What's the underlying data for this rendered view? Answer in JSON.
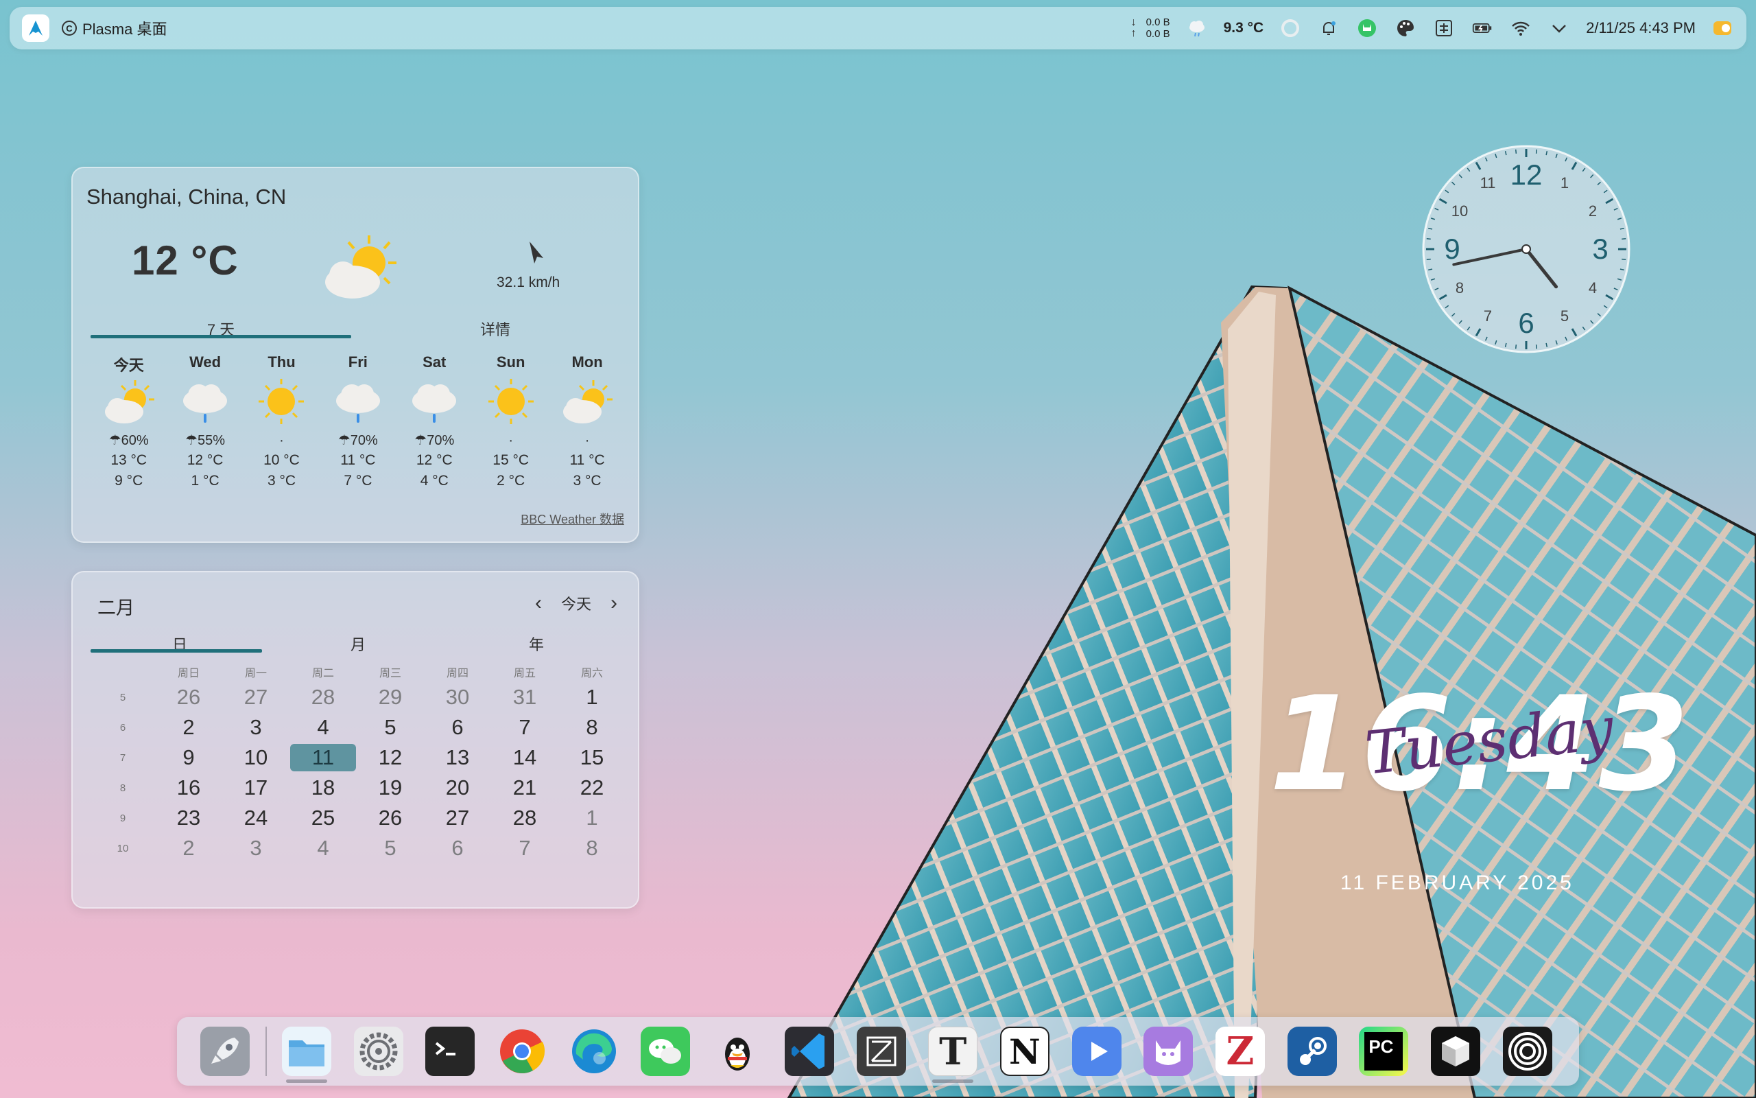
{
  "panel": {
    "app_title": "Plasma 桌面",
    "net_down": "0.0 B",
    "net_up": "0.0 B",
    "weather_temp": "9.3 °C",
    "datetime": "2/11/25 4:43 PM"
  },
  "weather": {
    "location": "Shanghai, China, CN",
    "temperature": "12 °C",
    "wind": "32.1 km/h",
    "tabs": [
      "7 天",
      "详情"
    ],
    "days": [
      {
        "name": "今天",
        "icon": "partly-cloudy-icon",
        "precip": "☂60%",
        "high": "13 °C",
        "low": "9 °C"
      },
      {
        "name": "Wed",
        "icon": "cloud-rain-icon",
        "precip": "☂55%",
        "high": "12 °C",
        "low": "1 °C"
      },
      {
        "name": "Thu",
        "icon": "sun-icon",
        "precip": "·",
        "high": "10 °C",
        "low": "3 °C"
      },
      {
        "name": "Fri",
        "icon": "cloud-rain-icon",
        "precip": "☂70%",
        "high": "11 °C",
        "low": "7 °C"
      },
      {
        "name": "Sat",
        "icon": "cloud-rain-icon",
        "precip": "☂70%",
        "high": "12 °C",
        "low": "4 °C"
      },
      {
        "name": "Sun",
        "icon": "sun-icon",
        "precip": "·",
        "high": "15 °C",
        "low": "2 °C"
      },
      {
        "name": "Mon",
        "icon": "partly-cloudy-icon",
        "precip": "·",
        "high": "11 °C",
        "low": "3 °C"
      }
    ],
    "source": "BBC Weather 数据"
  },
  "calendar": {
    "month": "二月",
    "today_label": "今天",
    "tabs": [
      "日",
      "月",
      "年"
    ],
    "weekdays": [
      "周日",
      "周一",
      "周二",
      "周三",
      "周四",
      "周五",
      "周六"
    ],
    "weeks": [
      {
        "num": "5",
        "days": [
          "26",
          "27",
          "28",
          "29",
          "30",
          "31",
          "1"
        ]
      },
      {
        "num": "6",
        "days": [
          "2",
          "3",
          "4",
          "5",
          "6",
          "7",
          "8"
        ]
      },
      {
        "num": "7",
        "days": [
          "9",
          "10",
          "11",
          "12",
          "13",
          "14",
          "15"
        ]
      },
      {
        "num": "8",
        "days": [
          "16",
          "17",
          "18",
          "19",
          "20",
          "21",
          "22"
        ]
      },
      {
        "num": "9",
        "days": [
          "23",
          "24",
          "25",
          "26",
          "27",
          "28",
          "1"
        ]
      },
      {
        "num": "10",
        "days": [
          "2",
          "3",
          "4",
          "5",
          "6",
          "7",
          "8"
        ]
      }
    ],
    "selected": "11"
  },
  "clock": {
    "numbers": [
      "12",
      "1",
      "2",
      "3",
      "4",
      "5",
      "6",
      "7",
      "8",
      "9",
      "10",
      "11"
    ],
    "hour": 4,
    "minute": 43
  },
  "digital": {
    "time": "16:43",
    "day": "Tuesday",
    "date": "11 FEBRUARY 2025"
  },
  "dock": {
    "apps": [
      {
        "name": "launcher",
        "icon": "rocket-icon",
        "color": "#8a8f99"
      },
      {
        "name": "files",
        "icon": "folder-icon",
        "color": "#6fb7e4"
      },
      {
        "name": "settings",
        "icon": "gear-icon",
        "color": "#8d8f93"
      },
      {
        "name": "terminal",
        "icon": "terminal-icon",
        "color": "#2b2b2b"
      },
      {
        "name": "chrome",
        "icon": "chrome-icon",
        "color": "#ea4335"
      },
      {
        "name": "edge",
        "icon": "edge-icon",
        "color": "#1b8ad3"
      },
      {
        "name": "wechat",
        "icon": "wechat-icon",
        "color": "#3ec95c"
      },
      {
        "name": "qq",
        "icon": "qq-icon",
        "color": "#1a1a1a"
      },
      {
        "name": "vscode",
        "icon": "vscode-icon",
        "color": "#2c2c32"
      },
      {
        "name": "zed",
        "icon": "zed-icon",
        "color": "#3d3d3d"
      },
      {
        "name": "typora",
        "icon": "typora-icon",
        "color": "#f2f2f2"
      },
      {
        "name": "notion",
        "icon": "notion-icon",
        "color": "#ffffff"
      },
      {
        "name": "video-player",
        "icon": "play-icon",
        "color": "#4f86ec"
      },
      {
        "name": "cat-app",
        "icon": "cat-icon",
        "color": "#a77be0"
      },
      {
        "name": "zotero",
        "icon": "zotero-icon",
        "color": "#ffffff"
      },
      {
        "name": "steam",
        "icon": "steam-icon",
        "color": "#1e5fa3"
      },
      {
        "name": "pycharm",
        "icon": "pycharm-icon",
        "color": "#21d789"
      },
      {
        "name": "cube-app",
        "icon": "cube-icon",
        "color": "#111111"
      },
      {
        "name": "circles-app",
        "icon": "circles-icon",
        "color": "#1a1a1a"
      }
    ],
    "typora_letter": "T",
    "notion_letter": "N",
    "zotero_letter": "Z",
    "pycharm_letters": "PC"
  }
}
